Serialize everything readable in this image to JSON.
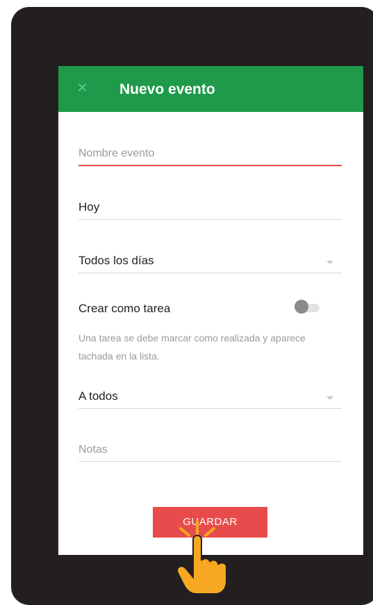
{
  "app_bar": {
    "close_icon": "close-icon",
    "title": "Nuevo evento"
  },
  "form": {
    "event_name_placeholder": "Nombre evento",
    "date_value": "Hoy",
    "repeat_value": "Todos los días",
    "task_label": "Crear como tarea",
    "task_help": "Una tarea se debe marcar como realizada y aparece tachada en la lista.",
    "assign_value": "A todos",
    "notes_placeholder": "Notas"
  },
  "save_button": {
    "label": "GUARDAR"
  },
  "colors": {
    "app_bar": "#1e9a4a",
    "accent": "#e84b4b",
    "device": "#231f20",
    "hand": "#f7a823"
  }
}
